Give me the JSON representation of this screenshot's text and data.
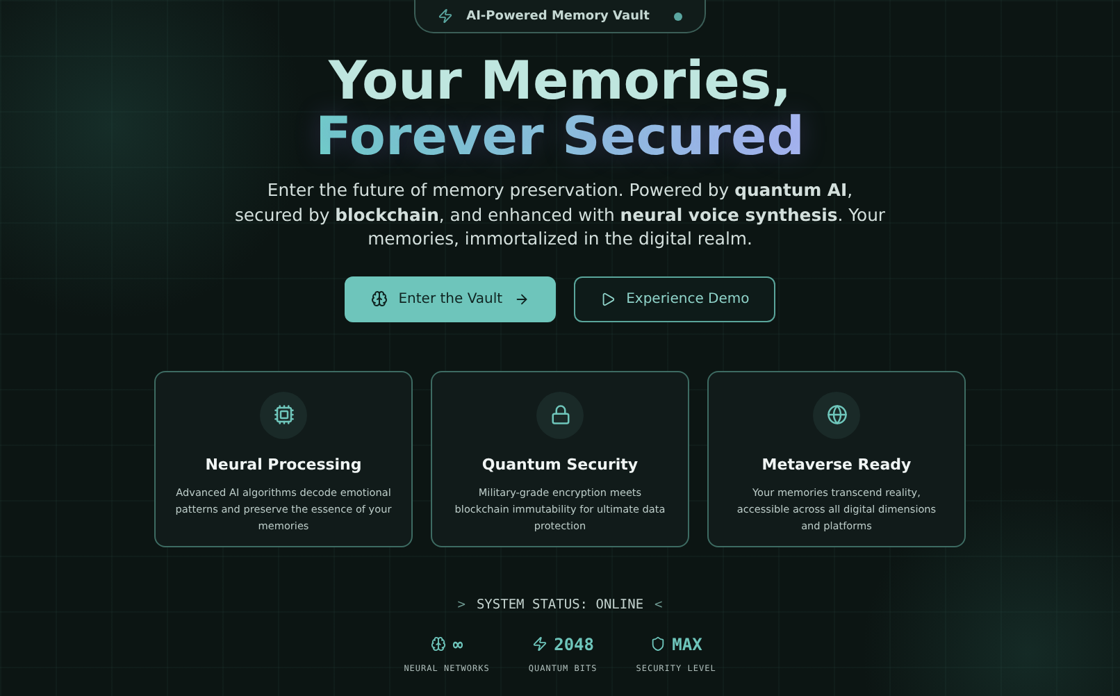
{
  "badge": {
    "label": "AI-Powered Memory Vault"
  },
  "headline": {
    "line_1": "Your Memories,",
    "line_2": "Forever Secured"
  },
  "description": "Enter the future of memory preservation. Powered by **quantum AI**, secured by **blockchain**, and enhanced with **neural voice synthesis**. Your memories, immortalized in the digital realm.",
  "buttons": [
    {
      "label": "Enter the Vault",
      "kind": "primary"
    },
    {
      "label": "Experience Demo",
      "kind": "secondary"
    }
  ],
  "features": [
    {
      "title": "Neural Processing",
      "text": "Advanced AI algorithms decode emotional patterns and preserve the essence of your memories"
    },
    {
      "title": "Quantum Security",
      "text": "Military-grade encryption meets blockchain immutability for ultimate data protection"
    },
    {
      "title": "Metaverse Ready",
      "text": "Your memories transcend reality, accessible across all digital dimensions and platforms"
    }
  ],
  "system_status": {
    "prefix": ">",
    "label": "SYSTEM STATUS: ONLINE",
    "suffix": "<"
  },
  "stats": [
    {
      "value": "∞",
      "label": "NEURAL NETWORKS"
    },
    {
      "value": "2048",
      "label": "QUANTUM BITS"
    },
    {
      "value": "MAX",
      "label": "SECURITY LEVEL"
    }
  ]
}
